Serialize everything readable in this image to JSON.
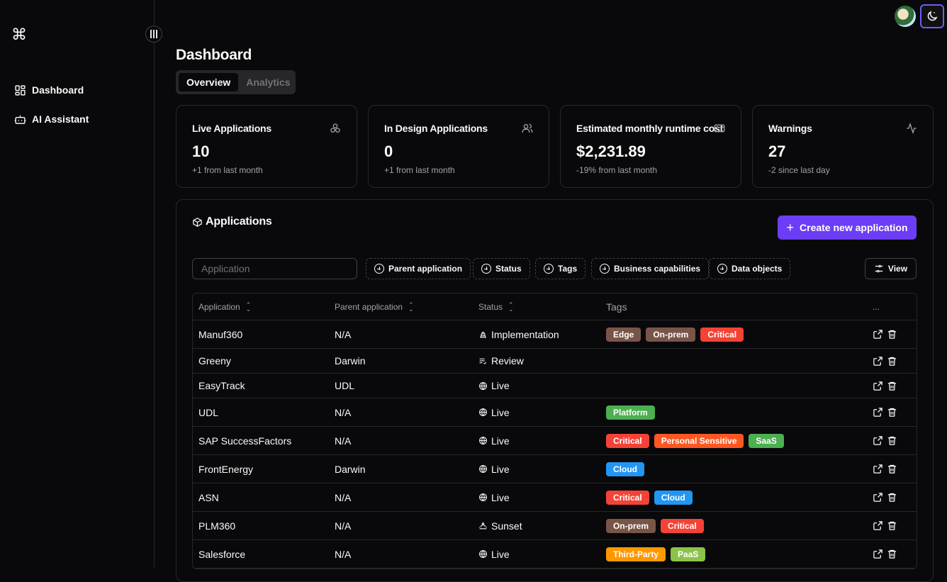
{
  "sidebar": {
    "logo": "⌘",
    "items": [
      {
        "label": "Dashboard",
        "icon": "dashboard-grid-icon"
      },
      {
        "label": "AI Assistant",
        "icon": "bot-icon"
      }
    ]
  },
  "header": {
    "title": "Dashboard"
  },
  "tabs": [
    {
      "label": "Overview",
      "active": true
    },
    {
      "label": "Analytics",
      "active": false
    }
  ],
  "cards": [
    {
      "title": "Live Applications",
      "value": "10",
      "sub": "+1 from last month",
      "icon": "cube-cluster-icon"
    },
    {
      "title": "In Design Applications",
      "value": "0",
      "sub": "+1 from last month",
      "icon": "users-icon"
    },
    {
      "title": "Estimated monthly runtime cost",
      "value": "$2,231.89",
      "sub": "-19% from last month",
      "icon": "credit-card-icon"
    },
    {
      "title": "Warnings",
      "value": "27",
      "sub": "-2 since last day",
      "icon": "activity-icon"
    }
  ],
  "applications": {
    "title": "Applications",
    "create_label": "Create new application",
    "search_placeholder": "Application",
    "filters": [
      "Parent application",
      "Status",
      "Tags",
      "Business capabilities",
      "Data objects"
    ],
    "view_label": "View",
    "columns": [
      "Application",
      "Parent application",
      "Status",
      "Tags",
      "..."
    ],
    "rows": [
      {
        "name": "Manuf360",
        "parent": "N/A",
        "status": "Implementation",
        "status_icon": "construction-icon",
        "tags": [
          "Edge",
          "On-prem",
          "Critical"
        ]
      },
      {
        "name": "Greeny",
        "parent": "Darwin",
        "status": "Review",
        "status_icon": "list-check-icon",
        "tags": []
      },
      {
        "name": "EasyTrack",
        "parent": "UDL",
        "status": "Live",
        "status_icon": "globe-icon",
        "tags": []
      },
      {
        "name": "UDL",
        "parent": "N/A",
        "status": "Live",
        "status_icon": "globe-icon",
        "tags": [
          "Platform"
        ]
      },
      {
        "name": "SAP SuccessFactors",
        "parent": "N/A",
        "status": "Live",
        "status_icon": "globe-icon",
        "tags": [
          "Critical",
          "Personal Sensitive",
          "SaaS"
        ]
      },
      {
        "name": "FrontEnergy",
        "parent": "Darwin",
        "status": "Live",
        "status_icon": "globe-icon",
        "tags": [
          "Cloud"
        ]
      },
      {
        "name": "ASN",
        "parent": "N/A",
        "status": "Live",
        "status_icon": "globe-icon",
        "tags": [
          "Critical",
          "Cloud"
        ]
      },
      {
        "name": "PLM360",
        "parent": "N/A",
        "status": "Sunset",
        "status_icon": "sunset-icon",
        "tags": [
          "On-prem",
          "Critical"
        ]
      },
      {
        "name": "Salesforce",
        "parent": "N/A",
        "status": "Live",
        "status_icon": "globe-icon",
        "tags": [
          "Third-Party",
          "PaaS"
        ]
      }
    ]
  },
  "tag_colors": {
    "Edge": "#795548",
    "On-prem": "#795548",
    "Critical": "#f44336",
    "Platform": "#4caf50",
    "Personal Sensitive": "#ff5722",
    "SaaS": "#4caf50",
    "Cloud": "#2196f3",
    "Third-Party": "#ff9800",
    "PaaS": "#8bc34a"
  },
  "accent": "#6d3df5"
}
